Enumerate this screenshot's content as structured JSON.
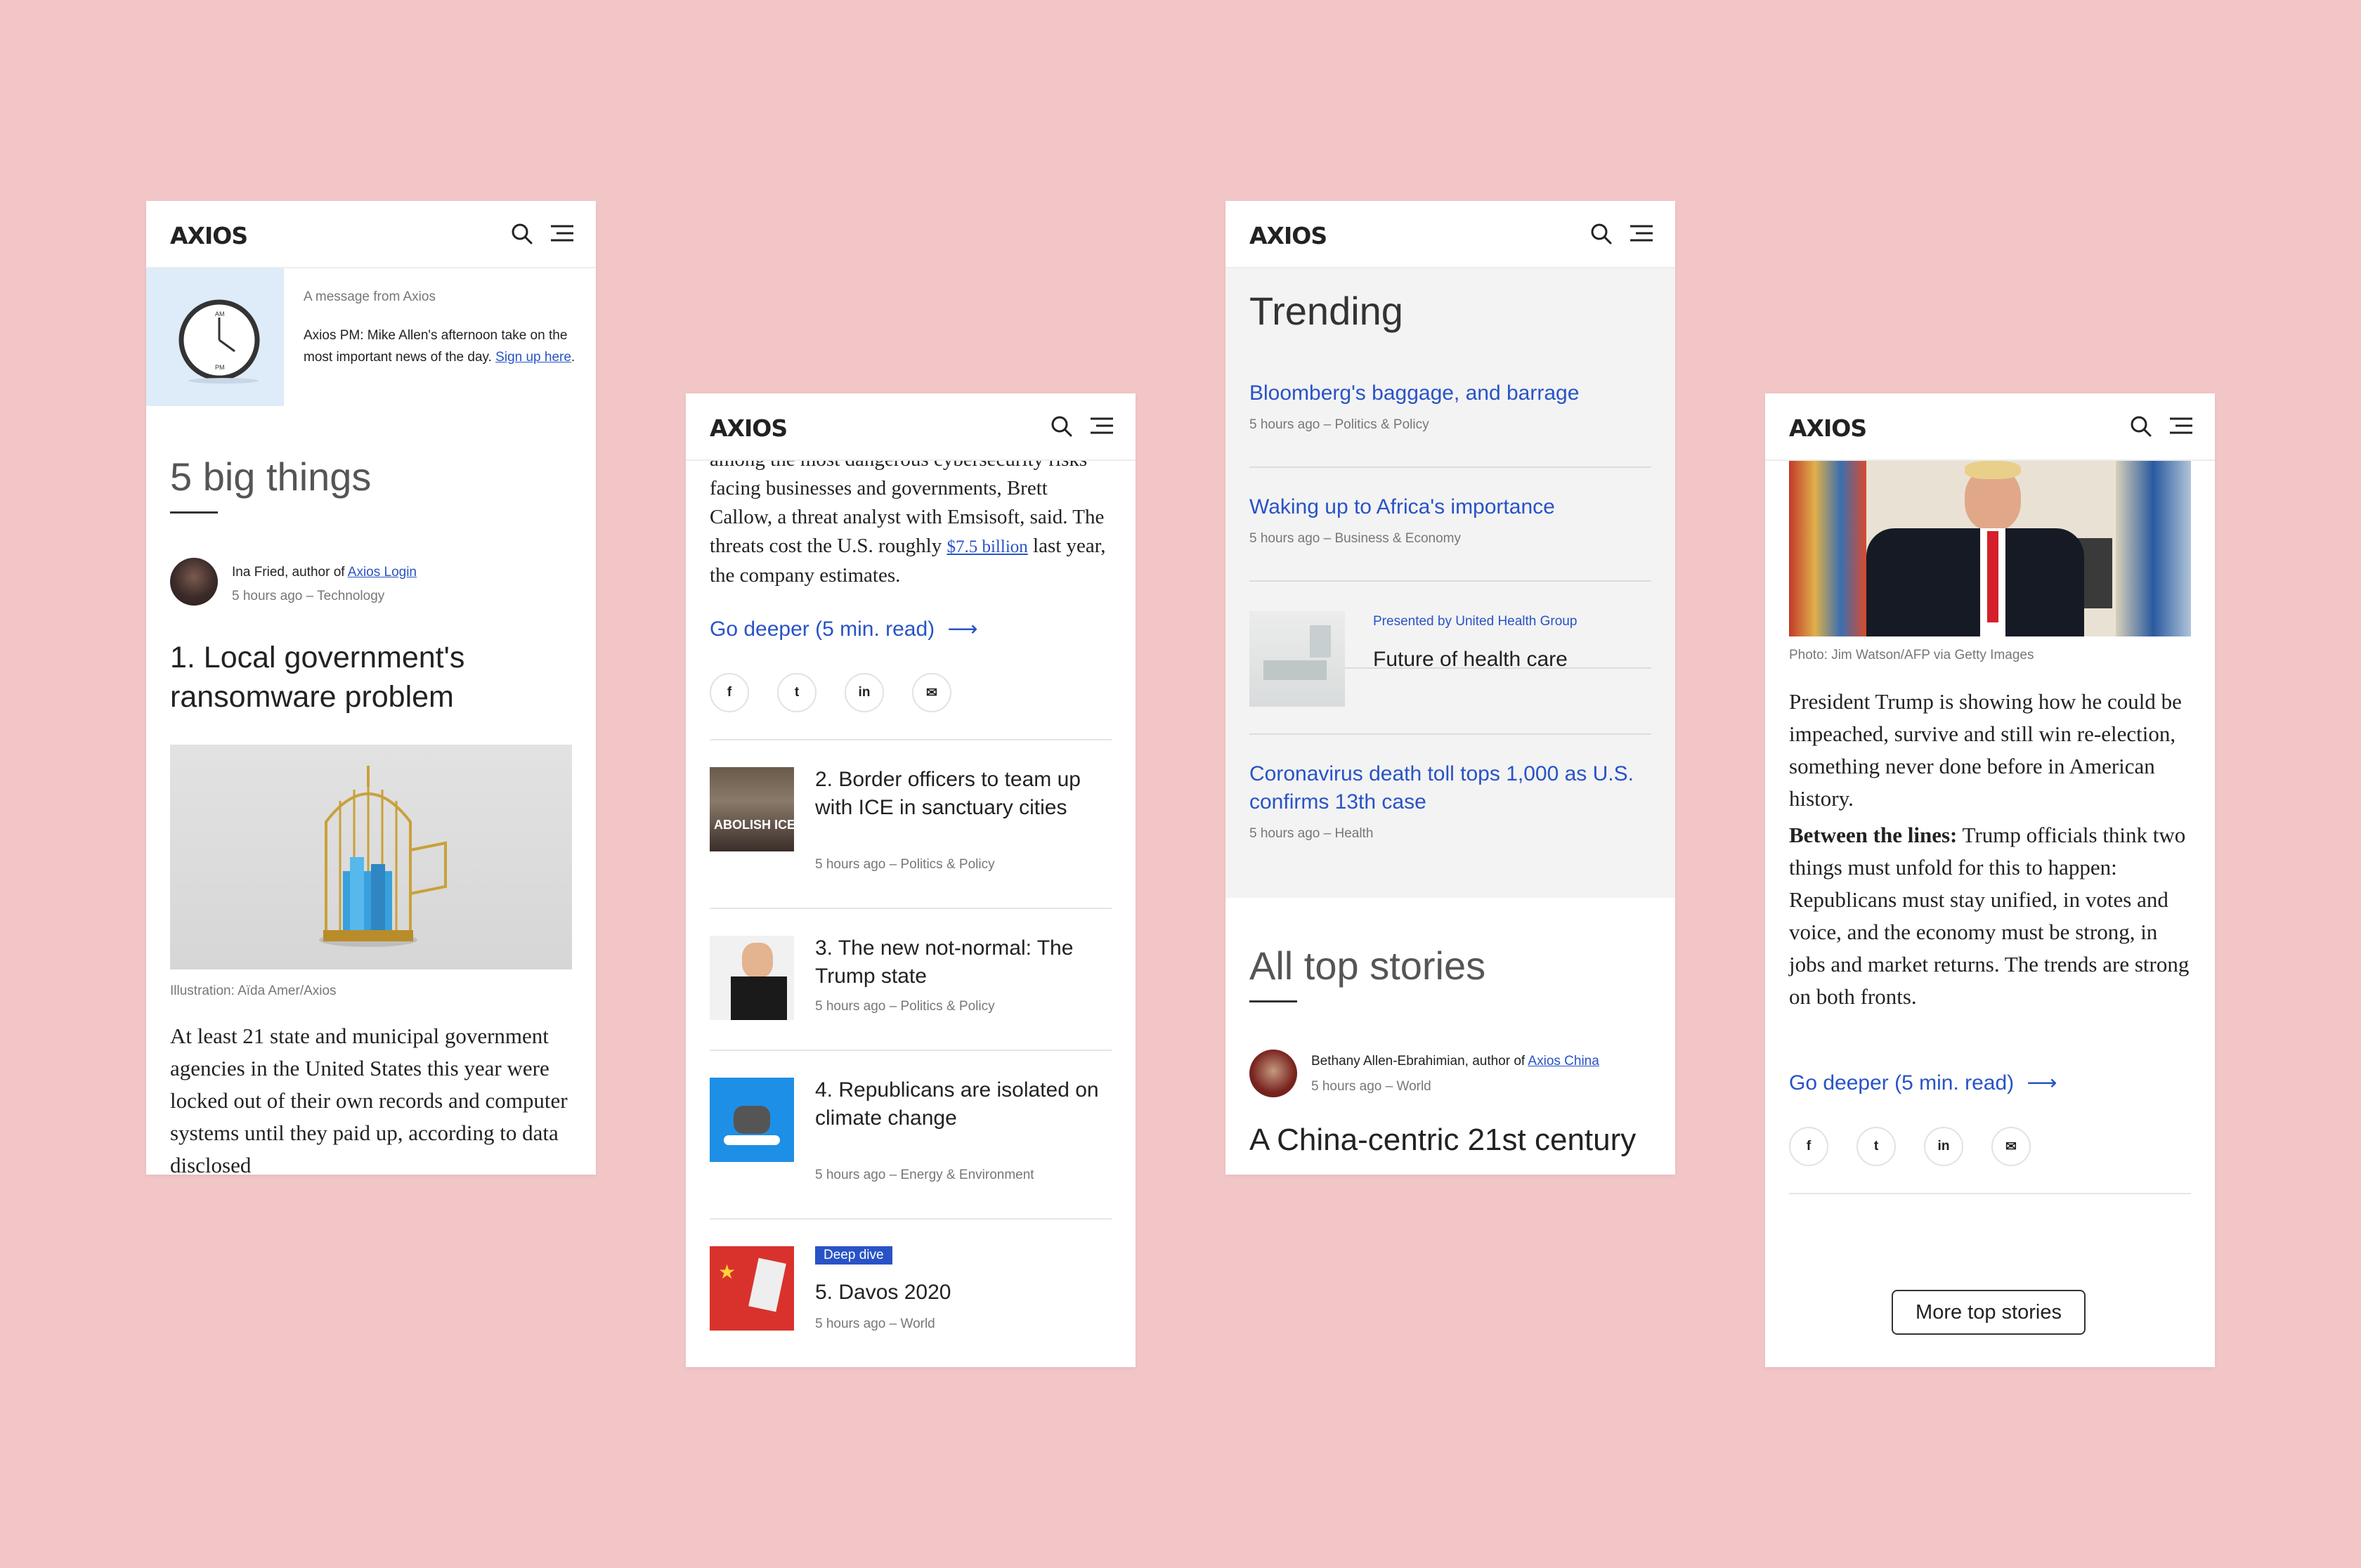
{
  "brand": {
    "logo": "AXIOS"
  },
  "screen1": {
    "promo": {
      "label": "A message from Axios",
      "text": "Axios PM: Mike Allen's afternoon take on the most important news of the day.",
      "link": "Sign up here",
      "suffix": ".",
      "clock_am": "AM",
      "clock_pm": "PM"
    },
    "section_title": "5 big things",
    "author": {
      "prefix": "Ina Fried, author of ",
      "newsletter": "Axios Login",
      "meta": "5 hours ago – Technology"
    },
    "headline": "1. Local government's ransomware problem",
    "caption": "Illustration: Aïda Amer/Axios",
    "body": "At least 21 state and municipal government agencies in the United States this year were locked out of their own records and computer systems until they paid up, according to data disclosed"
  },
  "screen2": {
    "body_pre": "among the most dangerous cybersecurity risks facing businesses and governments, Brett Callow, a threat analyst with Emsisoft, said. The threats cost the U.S. roughly ",
    "body_link": "$7.5 billion",
    "body_post": " last year, the company estimates.",
    "go_deeper": "Go deeper (5 min. read)",
    "social": [
      "f",
      "t",
      "in",
      "✉"
    ],
    "stories": [
      {
        "title": "2. Border officers to team up with ICE in sanctuary cities",
        "meta": "5 hours ago – Politics & Policy",
        "thumb_text": "ABOLISH ICE"
      },
      {
        "title": "3. The new not-normal: The Trump state",
        "meta": "5 hours ago – Politics & Policy"
      },
      {
        "title": "4. Republicans are isolated on climate change",
        "meta": "5 hours ago – Energy & Environment"
      },
      {
        "badge": "Deep dive",
        "title": "5. Davos 2020",
        "meta": "5 hours ago – World"
      }
    ]
  },
  "screen3": {
    "trending_title": "Trending",
    "trending": [
      {
        "title": "Bloomberg's baggage, and barrage",
        "meta": "5 hours ago – Politics & Policy"
      },
      {
        "title": "Waking up to Africa's importance",
        "meta": "5 hours ago – Business & Economy"
      }
    ],
    "sponsored": {
      "label": "Presented by United Health Group",
      "title": "Future of health care"
    },
    "trending_last": {
      "title": "Coronavirus death toll tops 1,000 as U.S. confirms 13th case",
      "meta": "5 hours ago – Health"
    },
    "all_title": "All top stories",
    "author": {
      "prefix": "Bethany Allen-Ebrahimian, author of ",
      "newsletter": "Axios China",
      "meta": "5 hours ago – World"
    },
    "headline": "A China-centric 21st century"
  },
  "screen4": {
    "caption": "Photo: Jim Watson/AFP via Getty Images",
    "body": "President Trump is showing how he could be impeached, survive and still win re-election, something never done before in American history.",
    "btl_label": "Between the lines:",
    "btl_text": " Trump officials think two things must unfold for this to happen: Republicans must stay unified, in votes and voice, and the economy must be strong, in jobs and market returns. The trends are strong on both fronts.",
    "go_deeper": "Go deeper (5 min. read)",
    "social": [
      "f",
      "t",
      "in",
      "✉"
    ],
    "more_button": "More top stories"
  },
  "colors": {
    "background": "#f2c6c7",
    "link": "#2853c7",
    "badge": "#2853c7",
    "promo_bg": "#deebf8",
    "trending_bg": "#f3f3f3"
  }
}
